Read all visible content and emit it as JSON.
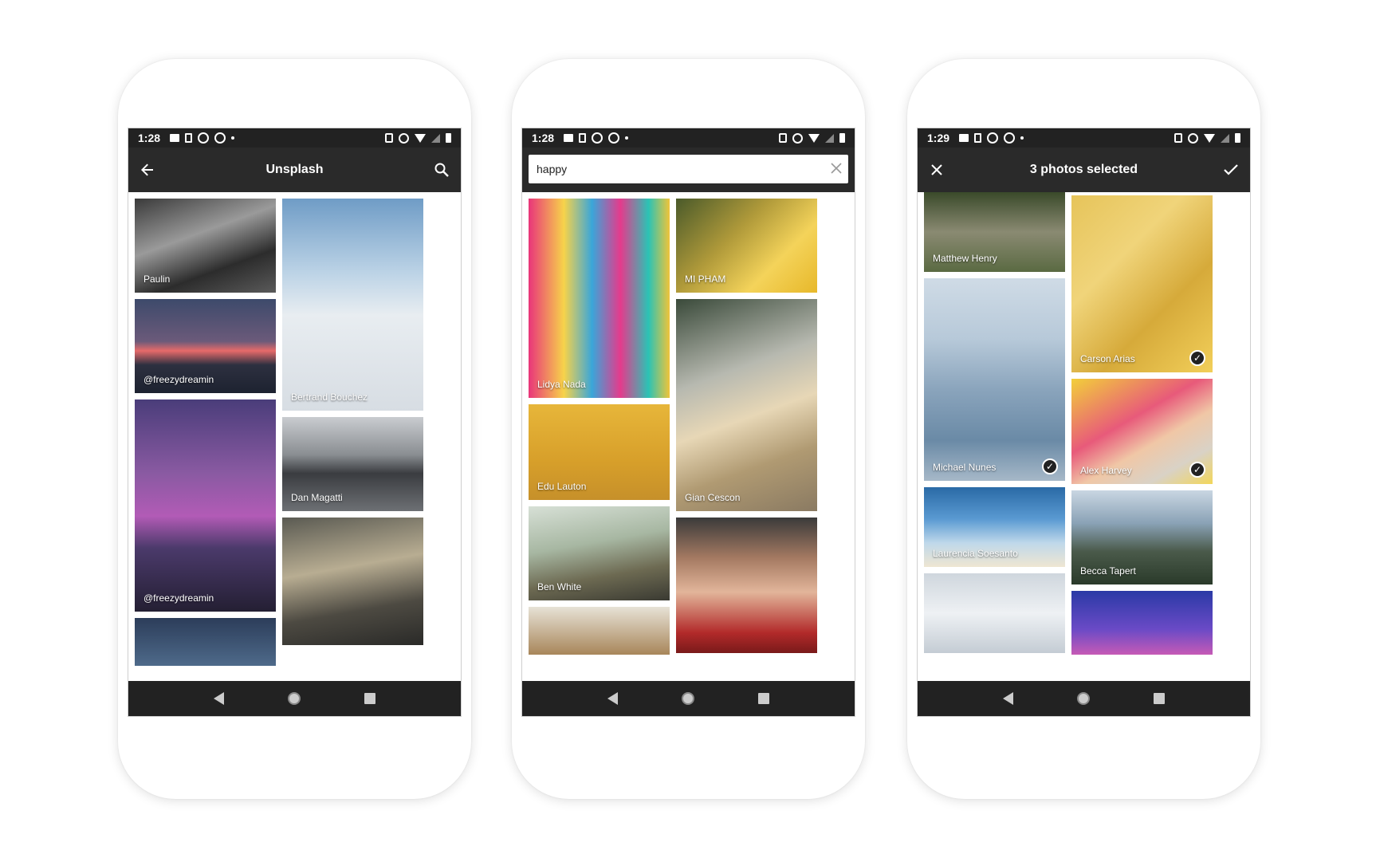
{
  "phones": [
    {
      "status": {
        "time": "1:28"
      },
      "appbar": {
        "title": "Unsplash",
        "back_icon": "arrow-left-icon",
        "action_icon": "search-icon"
      },
      "tiles": [
        {
          "caption": "Paulin",
          "bg": "linear-gradient(160deg,#3a3a3a 0%,#9a9a9a 40%,#2c2c2c 70%,#5a5a5a 100%)"
        },
        {
          "caption": "Bertrand Bouchez",
          "bg": "linear-gradient(180deg,#6f9cc6 0%,#bcd3e6 35%,#e8edf1 55%,#d7dde3 100%)"
        },
        {
          "caption": "@freezydreamin",
          "bg": "linear-gradient(180deg,#3d4a6b 0%,#6b5a7a 45%,#e76a6a 55%,#2d3040 70%,#1d2230 100%)"
        },
        {
          "caption": "Dan Magatti",
          "bg": "linear-gradient(180deg,#c9ccd0 0%,#8a8e92 40%,#3a3c40 60%,#6d7074 100%)"
        },
        {
          "caption": "@freezydreamin",
          "bg": "linear-gradient(180deg,#4a3d7a 0%,#8a5aa2 35%,#b25bb6 55%,#4b3a6b 70%,#241f33 100%)"
        },
        {
          "caption": "",
          "bg": "linear-gradient(170deg,#5a5a52 0%,#b8ad92 40%,#4d4a42 70%,#2a2a28 100%)"
        },
        {
          "caption": "",
          "bg": "linear-gradient(180deg,#2c3d5a 0%,#4e6a8a 100%)"
        }
      ]
    },
    {
      "status": {
        "time": "1:28"
      },
      "search": {
        "value": "happy",
        "clear_icon": "close-icon"
      },
      "tiles": [
        {
          "caption": "Lidya Nada",
          "bg": "linear-gradient(90deg,#e9357a 0%,#f7d34a 25%,#3aa6d9 45%,#e53a8c 65%,#2bc3b5 85%,#f0c43a 100%)"
        },
        {
          "caption": "MI PHAM",
          "bg": "linear-gradient(135deg,#4a5a2a 0%,#b09a3a 40%,#f4d35a 70%,#e7b82a 100%)"
        },
        {
          "caption": "Edu Lauton",
          "bg": "linear-gradient(180deg,#e7b63a 0%,#d79f2a 60%,#c6902a 100%)"
        },
        {
          "caption": "Gian Cescon",
          "bg": "linear-gradient(160deg,#3a4a3a 0%,#b7b9b0 35%,#e7d7b6 55%,#b09a72 75%,#8a7a62 100%)"
        },
        {
          "caption": "Ben White",
          "bg": "linear-gradient(170deg,#d7e0d6 0%,#a7b7a2 40%,#6d6a52 70%,#3a3a32 100%)"
        },
        {
          "caption": "",
          "bg": "linear-gradient(180deg,#3a3a3a 0%,#a57a62 30%,#e2b59a 55%,#b22a2a 85%,#7a1a1a 100%)"
        },
        {
          "caption": "",
          "bg": "linear-gradient(180deg,#e7e2d6 0%,#a8865a 100%)"
        }
      ]
    },
    {
      "status": {
        "time": "1:29"
      },
      "appbar": {
        "title": "3 photos selected",
        "close_icon": "close-icon",
        "confirm_icon": "check-icon"
      },
      "tiles": [
        {
          "caption": "Matthew Henry",
          "bg": "linear-gradient(180deg,#3a4a2a 0%,#8a8a72 50%,#5a6a42 100%)",
          "selected": false
        },
        {
          "caption": "Carson Arias",
          "bg": "linear-gradient(135deg,#e6c45a 0%,#f0d47a 35%,#d6aa3a 65%,#f2cf5a 100%)",
          "selected": true
        },
        {
          "caption": "Michael Nunes",
          "bg": "linear-gradient(180deg,#cfdbe6 0%,#b7c9d9 30%,#8aa4bc 55%,#6a8aa6 80%,#a6b8c8 100%)",
          "selected": true
        },
        {
          "caption": "Alex Harvey",
          "bg": "linear-gradient(150deg,#f2cf3a 0%,#e85a7a 40%,#f0c7a6 60%,#d9d2c6 80%,#f2d65a 100%)",
          "selected": true
        },
        {
          "caption": "Laurencia Soesanto",
          "bg": "linear-gradient(180deg,#2a6aa6 0%,#5a9ad2 40%,#bfd8ea 70%,#efe6d2 100%)",
          "selected": false
        },
        {
          "caption": "Becca Tapert",
          "bg": "linear-gradient(180deg,#c9d6e2 0%,#8aa2b6 35%,#4a5a4a 65%,#2a3a2a 100%)",
          "selected": false
        },
        {
          "caption": "",
          "bg": "linear-gradient(180deg,#cfd6dd 0%,#eef1f4 50%,#c4ccd4 100%)",
          "selected": false
        },
        {
          "caption": "",
          "bg": "linear-gradient(180deg,#2a3aa6 0%,#6a4ac6 60%,#c65ab6 100%)",
          "selected": false
        }
      ]
    }
  ]
}
